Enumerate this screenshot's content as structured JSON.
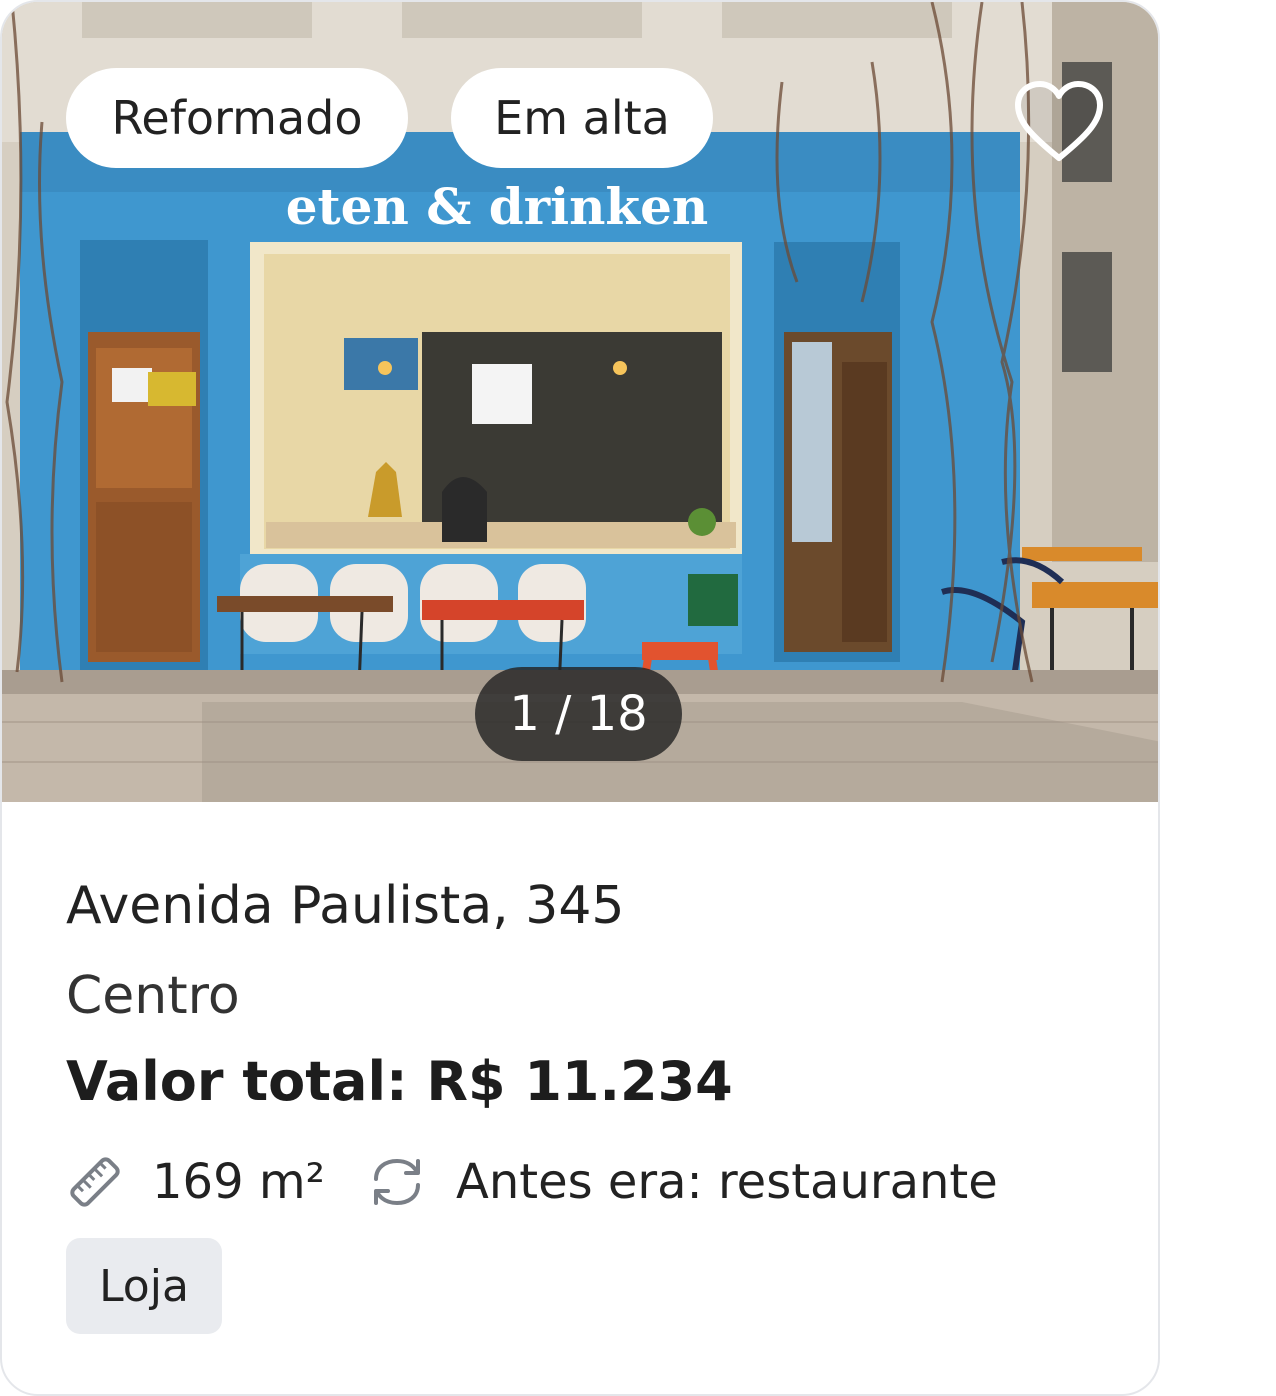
{
  "listing": {
    "badges": [
      "Reformado",
      "Em alta"
    ],
    "photo_counter": "1 / 18",
    "storefront_sign": "eten & drinken",
    "address": "Avenida Paulista, 345",
    "neighborhood": "Centro",
    "price": "Valor total: R$ 11.234",
    "area": "169 m²",
    "previous_use": "Antes era: restaurante",
    "category_tag": "Loja"
  },
  "icons": {
    "favorite": "heart-outline-icon",
    "area": "ruler-icon",
    "previous_use": "cycle-arrows-icon"
  },
  "colors": {
    "facade_blue": "#3f97cf",
    "badge_bg": "#ffffff",
    "tag_bg": "#e9ebef"
  }
}
